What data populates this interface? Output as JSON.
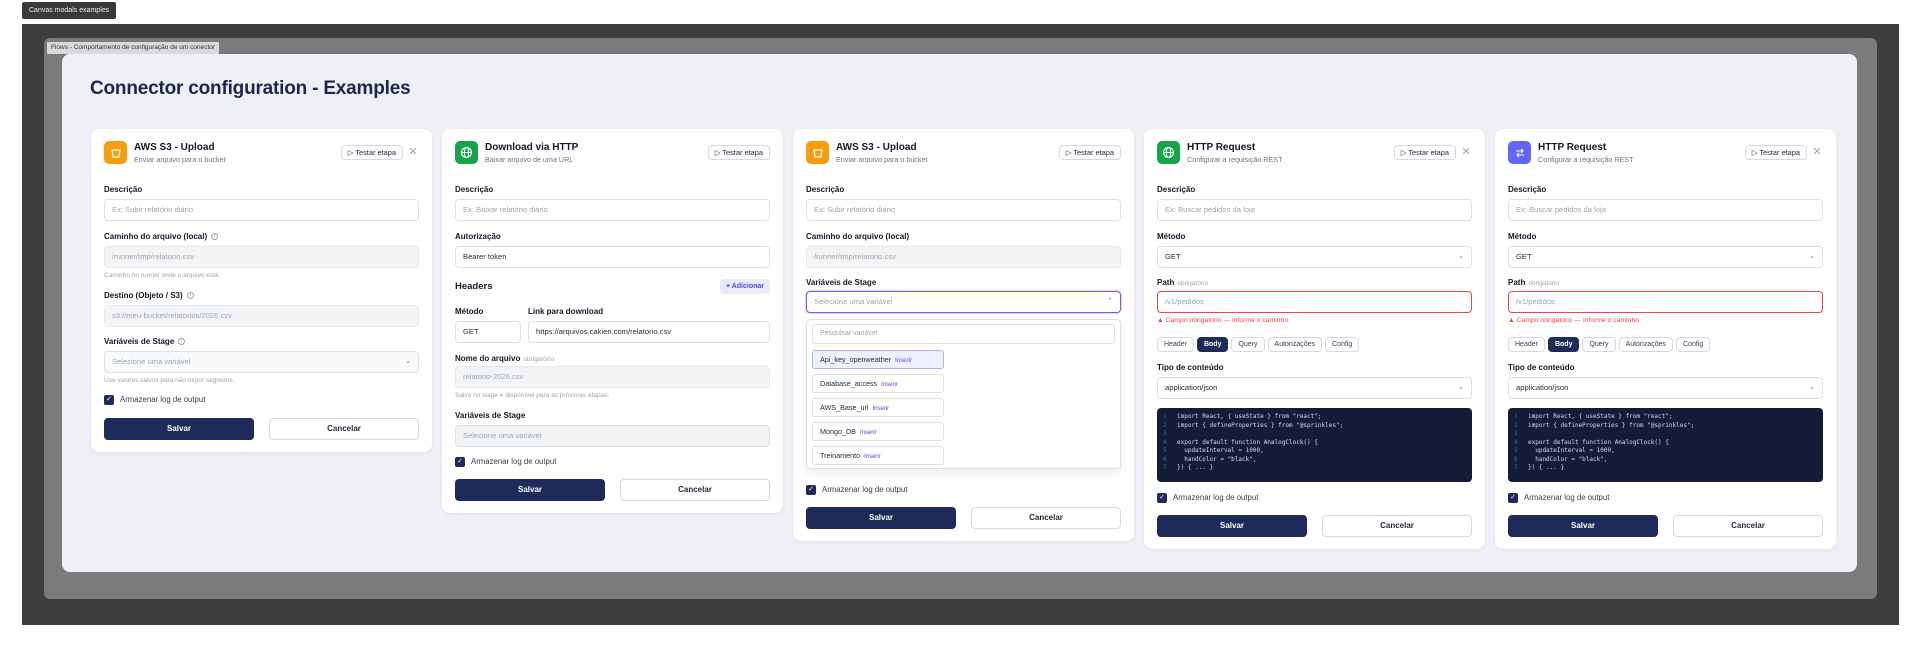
{
  "top_chip": "Canvas modals examples",
  "frame_label": "Flows - Comportamento de configuração de um conector",
  "canvas_title": "Connector configuration - Examples",
  "colors": {
    "primary": "#1e2a5a",
    "s3": "#f59e0b",
    "http_green": "#16a34a",
    "http_purple": "#6366f1",
    "error": "#ef4444"
  },
  "common": {
    "test_btn": "Testar etapa",
    "test_icon": "play-icon",
    "save": "Salvar",
    "cancel": "Cancelar",
    "log_checkbox": "Armazenar log de output",
    "close_icon": "close-icon"
  },
  "card1": {
    "title": "AWS S3 - Upload",
    "subtitle": "Enviar arquivo para o bucket",
    "icon": "bucket-icon",
    "desc_label": "Descrição",
    "desc_placeholder": "Ex: Subir relatório diário",
    "path_label": "Caminho do arquivo (local)",
    "path_value": "/runner/tmp/relatorio.csv",
    "path_help": "Caminho no runner onde o arquivo está.",
    "dest_label": "Destino (Objeto / S3)",
    "dest_value": "s3://meu-bucket/relatorios/2026.csv",
    "vars_label": "Variáveis de Stage",
    "vars_placeholder": "Selecione uma variável",
    "vars_help": "Use valores salvos para não expor segredos."
  },
  "card2": {
    "title": "Download via HTTP",
    "subtitle": "Baixar arquivo de uma URL",
    "icon": "globe-icon",
    "desc_label": "Descrição",
    "desc_placeholder": "Ex: Baixar relatório diário",
    "auth_label": "Autorização",
    "auth_value": "Bearer token",
    "headers_label": "Headers",
    "add_label": "+ Adicionar",
    "method_label": "Método",
    "method_value": "GET",
    "link_label": "Link para download",
    "link_value": "https://arquivos.cakien.com/relatorio.csv",
    "filename_label": "Nome do arquivo",
    "filename_hint": "obrigatório",
    "filename_placeholder": "relatorio-2026.csv",
    "filename_help": "Salvo no stage e disponível para as próximas etapas.",
    "vars_label": "Variáveis de Stage",
    "vars_placeholder": "Selecione uma variável"
  },
  "card3": {
    "title": "AWS S3 - Upload",
    "subtitle": "Enviar arquivo para o bucket",
    "icon": "bucket-icon",
    "desc_label": "Descrição",
    "desc_placeholder": "Ex: Subir relatório diário",
    "path_label": "Caminho do arquivo (local)",
    "path_value": "/runner/tmp/relatorio.csv",
    "vars_label": "Variáveis de Stage",
    "vars_placeholder": "Selecione uma variável",
    "search_placeholder": "Pesquisar variável",
    "insert_label": "Inserir",
    "options": [
      "Api_key_openweather",
      "Database_access",
      "AWS_Base_url",
      "Mongo_DB",
      "Treinamento"
    ]
  },
  "card4": {
    "title": "HTTP Request",
    "subtitle": "Configurar a requisição REST",
    "icon": "globe-icon",
    "desc_label": "Descrição",
    "desc_placeholder": "Ex: Buscar pedidos da loja",
    "method_label": "Método",
    "method_value": "GET",
    "path_label": "Path",
    "path_hint": "obrigatório",
    "path_placeholder": "/v1/pedidos",
    "path_error": "Campo obrigatório — informe o caminho.",
    "tabs": [
      "Header",
      "Body",
      "Query",
      "Autorizações",
      "Config"
    ],
    "active_tab": "Body",
    "content_type_label": "Tipo de conteúdo",
    "content_type_value": "application/json",
    "code": [
      {
        "n": "1",
        "t": "import React, { useState } from \"react\";"
      },
      {
        "n": "2",
        "t": "import { defineProperties } from \"@sprinkles\";"
      },
      {
        "n": "3",
        "t": ""
      },
      {
        "n": "4",
        "t": "export default function AnalogClock() {"
      },
      {
        "n": "5",
        "t": "  updateInterval = 1000,"
      },
      {
        "n": "6",
        "t": "  handColor = \"black\","
      },
      {
        "n": "7",
        "t": "}) { ... }"
      }
    ]
  },
  "card5": {
    "title": "HTTP Request",
    "subtitle": "Configurar a requisição REST",
    "icon": "swap-icon",
    "desc_label": "Descrição",
    "desc_placeholder": "Ex: Buscar pedidos da loja",
    "method_label": "Método",
    "method_value": "GET",
    "path_label": "Path",
    "path_hint": "obrigatório",
    "path_placeholder": "/v1/pedidos",
    "path_error": "Campo obrigatório — informe o caminho.",
    "tabs": [
      "Header",
      "Body",
      "Query",
      "Autorizações",
      "Config"
    ],
    "active_tab": "Body",
    "content_type_label": "Tipo de conteúdo",
    "content_type_value": "application/json",
    "code": [
      {
        "n": "1",
        "t": "import React, { useState } from \"react\";"
      },
      {
        "n": "2",
        "t": "import { defineProperties } from \"@sprinkles\";"
      },
      {
        "n": "3",
        "t": ""
      },
      {
        "n": "4",
        "t": "export default function AnalogClock() {"
      },
      {
        "n": "5",
        "t": "  updateInterval = 1000,"
      },
      {
        "n": "6",
        "t": "  handColor = \"black\","
      },
      {
        "n": "7",
        "t": "}) { ... }"
      }
    ]
  }
}
